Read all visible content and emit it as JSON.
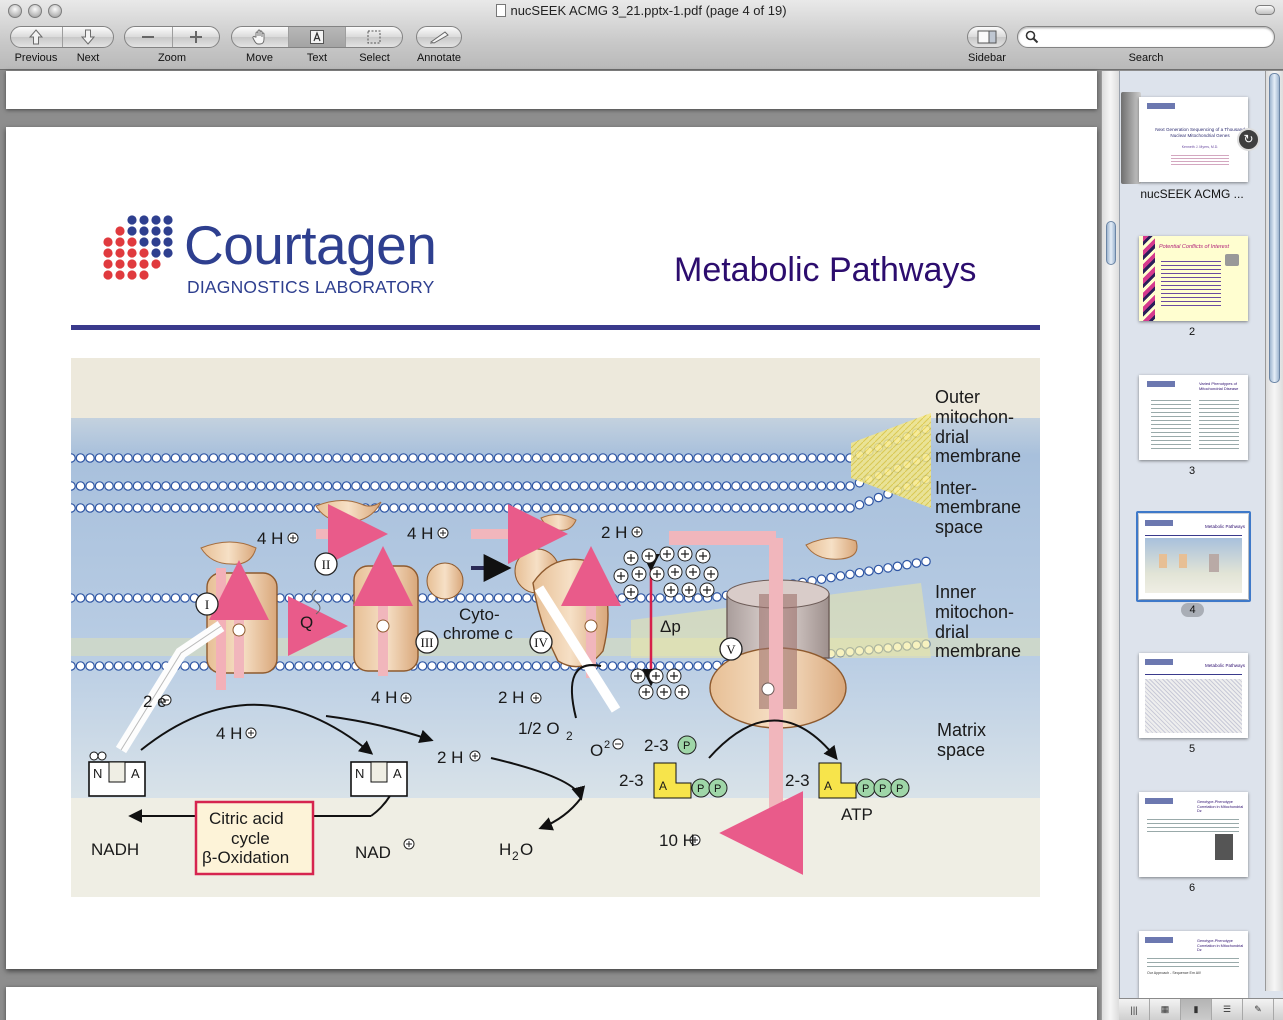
{
  "window": {
    "title": "nucSEEK ACMG 3_21.pptx-1.pdf (page 4 of 19)"
  },
  "toolbar": {
    "previous_label": "Previous",
    "next_label": "Next",
    "zoom_label": "Zoom",
    "move_label": "Move",
    "text_label": "Text",
    "select_label": "Select",
    "annotate_label": "Annotate",
    "sidebar_label": "Sidebar",
    "search_label": "Search",
    "search_value": ""
  },
  "slide": {
    "logo_name": "Courtagen",
    "logo_subtitle": "DIAGNOSTICS LABORATORY",
    "title": "Metabolic Pathways",
    "logo_dot_colors": [
      "#2e3f8f",
      "#e03a3e"
    ],
    "figure": {
      "outer_membrane": [
        "Outer",
        "mitochon-",
        "drial",
        "membrane"
      ],
      "intermembrane": [
        "Inter-",
        "membrane",
        "space"
      ],
      "inner_membrane": [
        "Inner",
        "mitochon-",
        "drial",
        "membrane"
      ],
      "matrix": [
        "Matrix",
        "space"
      ],
      "complexes": [
        "I",
        "II",
        "III",
        "IV",
        "V"
      ],
      "q": "Q",
      "cytochrome": [
        "Cyto-",
        "chrome c"
      ],
      "h4_a": "4 H",
      "h4_b": "4 H",
      "h2_top": "2 H",
      "h4_matrix_a": "4 H",
      "h4_matrix_b": "4 H",
      "h2_matrix_a": "2 H",
      "h2_matrix_b": "2 H",
      "h10": "10 H",
      "two_e": "2 e",
      "half_o2": "1/2 O",
      "o2_sub": "2",
      "o2minus": "O",
      "o2minus_sup": "2",
      "dp": "Δp",
      "p23a": "2-3",
      "p23b": "2-3",
      "p23c": "2-3",
      "p": "P",
      "atp": "ATP",
      "nadh": "NADH",
      "nad": "NAD",
      "h2o": "H",
      "h2o_sub": "2",
      "h2o_o": "O",
      "cycle": [
        "Citric acid",
        "cycle",
        "β-Oxidation"
      ],
      "n": "N",
      "a": "A"
    }
  },
  "sidebar": {
    "thumbnails": [
      {
        "caption": "nucSEEK ACMG ...",
        "title": "Next Generation Sequencing of a Thousand Nuclear Mitochondrial Genes"
      },
      {
        "caption": "2",
        "title": "Potential Conflicts of Interest"
      },
      {
        "caption": "3",
        "title": "Varied Phenotypes of Mitochondrial Disease"
      },
      {
        "caption": "4",
        "title": "Metabolic Pathways"
      },
      {
        "caption": "5",
        "title": "Metabolic Pathways"
      },
      {
        "caption": "6",
        "title": "Genotype-Phenotype Correlation in Mitochondrial Dz"
      },
      {
        "caption": "",
        "title": "Genotype-Phenotype Correlation in Mitochondrial Dz"
      }
    ],
    "sub_texts": {
      "t1": "Kenneth J. Myers, M.D.",
      "t6": "Our Approach - Sequence Em All!"
    }
  }
}
